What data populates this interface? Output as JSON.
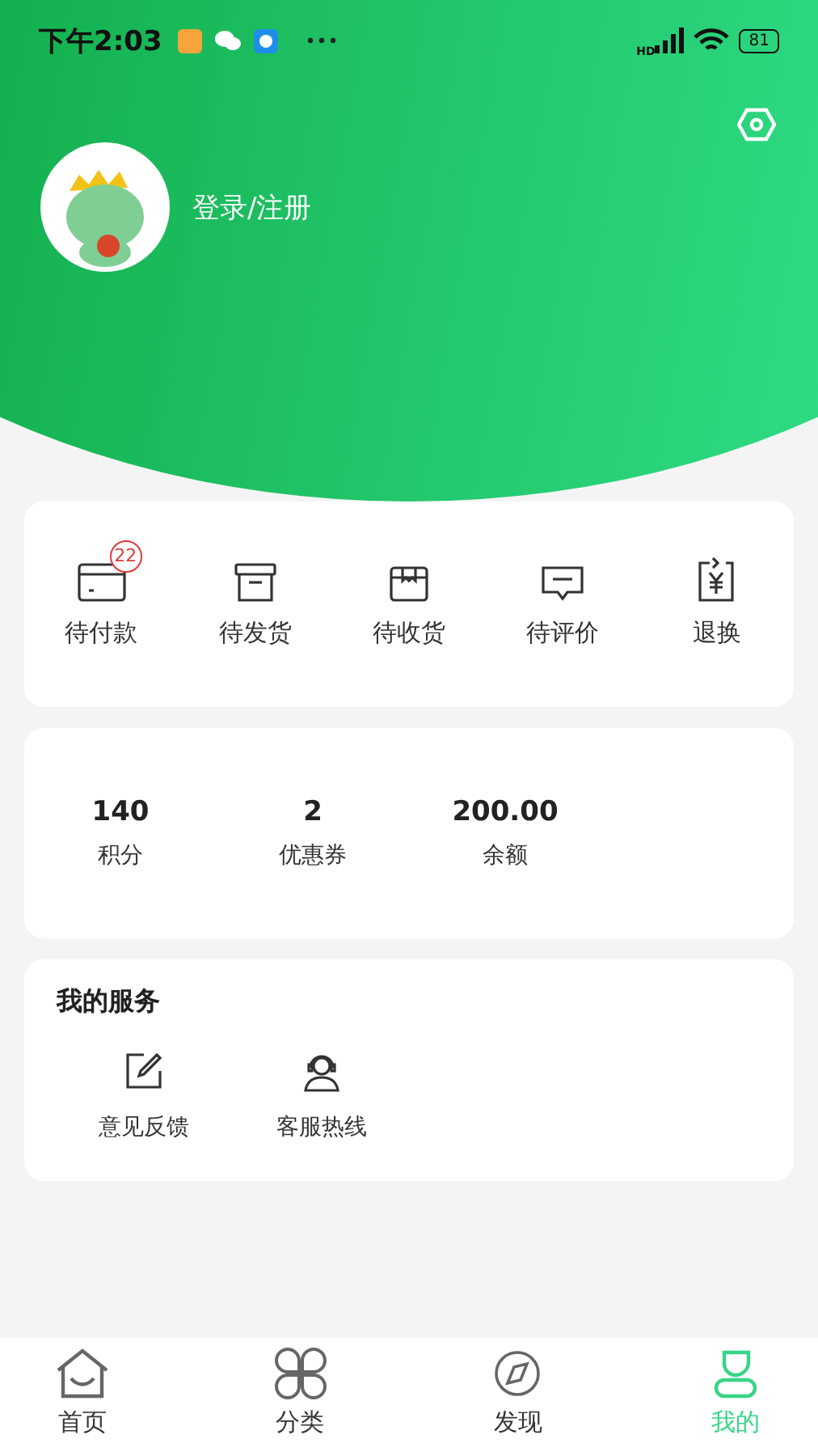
{
  "status_bar": {
    "time": "下午2:03",
    "signal_label": "HD",
    "battery": "81"
  },
  "profile": {
    "login_label": "登录/注册"
  },
  "orders": [
    {
      "label": "待付款",
      "kind": "card",
      "badge": "22"
    },
    {
      "label": "待发货",
      "kind": "box"
    },
    {
      "label": "待收货",
      "kind": "parcel"
    },
    {
      "label": "待评价",
      "kind": "comment"
    },
    {
      "label": "退换",
      "kind": "refund"
    }
  ],
  "stats": [
    {
      "value": "140",
      "label": "积分"
    },
    {
      "value": "2",
      "label": "优惠券"
    },
    {
      "value": "200.00",
      "label": "余额"
    }
  ],
  "services": {
    "title": "我的服务",
    "items": [
      {
        "label": "意见反馈",
        "kind": "feedback"
      },
      {
        "label": "客服热线",
        "kind": "support"
      }
    ]
  },
  "tabs": [
    {
      "label": "首页",
      "kind": "home",
      "selected": false
    },
    {
      "label": "分类",
      "kind": "category",
      "selected": false
    },
    {
      "label": "发现",
      "kind": "discover",
      "selected": false
    },
    {
      "label": "我的",
      "kind": "me",
      "selected": true
    }
  ]
}
